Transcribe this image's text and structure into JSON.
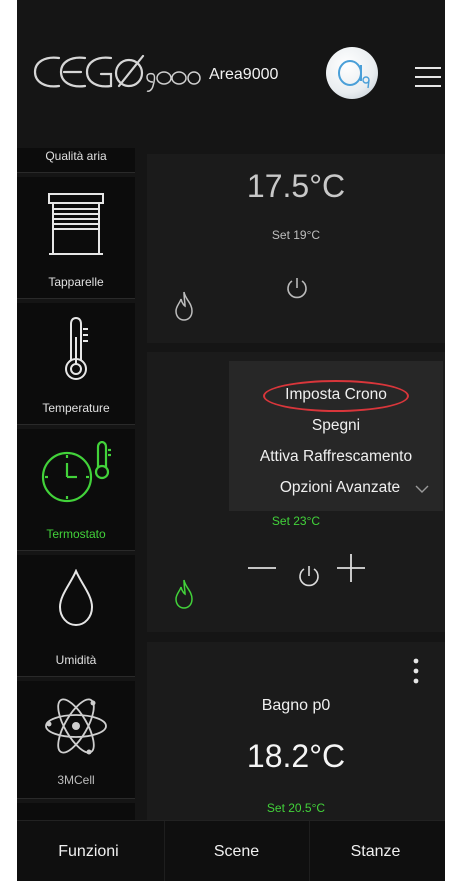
{
  "header": {
    "logo_text": "EGO9000",
    "area_name": "Area9000",
    "a9_logo_text": "a9"
  },
  "sidebar": {
    "items": [
      {
        "label": "Qualità aria",
        "icon": "air-quality-icon"
      },
      {
        "label": "Tapparelle",
        "icon": "shutter-icon"
      },
      {
        "label": "Temperature",
        "icon": "thermometer-icon"
      },
      {
        "label": "Termostato",
        "icon": "clock-thermometer-icon",
        "active": true
      },
      {
        "label": "Umidità",
        "icon": "water-drop-icon"
      },
      {
        "label": "3MCell",
        "icon": "atom-icon"
      }
    ]
  },
  "cards": [
    {
      "temperature": "17.5°C",
      "setpoint": "Set 19°C",
      "flame_active": false
    },
    {
      "setpoint": "Set 23°C",
      "flame_active": true
    },
    {
      "name": "Bagno p0",
      "temperature": "18.2°C",
      "setpoint": "Set 20.5°C"
    }
  ],
  "popup_menu": {
    "items": [
      "Imposta Crono",
      "Spegni",
      "Attiva Raffrescamento",
      "Opzioni Avanzate"
    ]
  },
  "tabs": [
    "Funzioni",
    "Scene",
    "Stanze"
  ],
  "colors": {
    "background": "#151515",
    "card": "#1b1b1b",
    "accent_green": "#42d23a",
    "highlight_red": "#d9363b",
    "popup": "#272727"
  }
}
